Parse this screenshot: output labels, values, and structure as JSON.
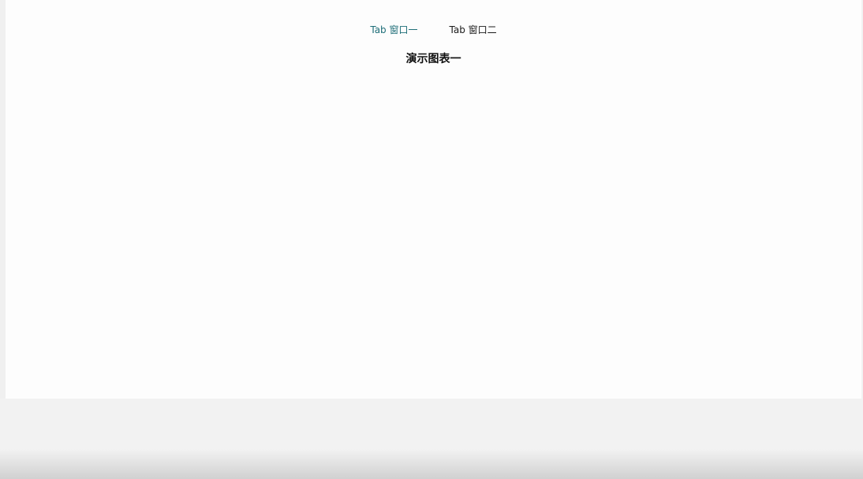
{
  "tabs": [
    {
      "label": "Tab 窗口一",
      "active": true
    },
    {
      "label": "Tab 窗口二",
      "active": false
    }
  ],
  "chart": {
    "title": "演示图表一"
  },
  "colors": {
    "active_tab": "#1e6e78",
    "inactive_tab": "#1a1a1a",
    "panel_background": "#fdfdfd",
    "page_background": "#f2f2f2"
  }
}
